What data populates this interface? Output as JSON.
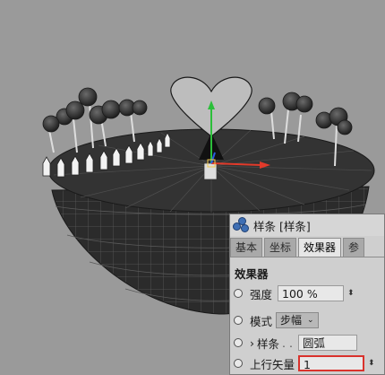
{
  "scene": {
    "background_color": "#9a9a9a",
    "object": "floating-island-with-trees-fence-heart"
  },
  "panel": {
    "title": "样条 [样条]",
    "icon": "spline-nodes-icon",
    "tabs": [
      {
        "label": "基本",
        "active": false
      },
      {
        "label": "坐标",
        "active": false
      },
      {
        "label": "效果器",
        "active": true
      },
      {
        "label": "参",
        "active": false
      }
    ],
    "section_title": "效果器",
    "strength": {
      "label": "强度",
      "value": "100 %"
    },
    "mode": {
      "label": "模式",
      "value": "步幅"
    },
    "spline": {
      "prefix": "›",
      "label": "样条",
      "dots": ". .",
      "value": "圆弧"
    },
    "up_vector": {
      "label": "上行矢量",
      "value": "1"
    },
    "highlight_color": "#d9322c"
  }
}
